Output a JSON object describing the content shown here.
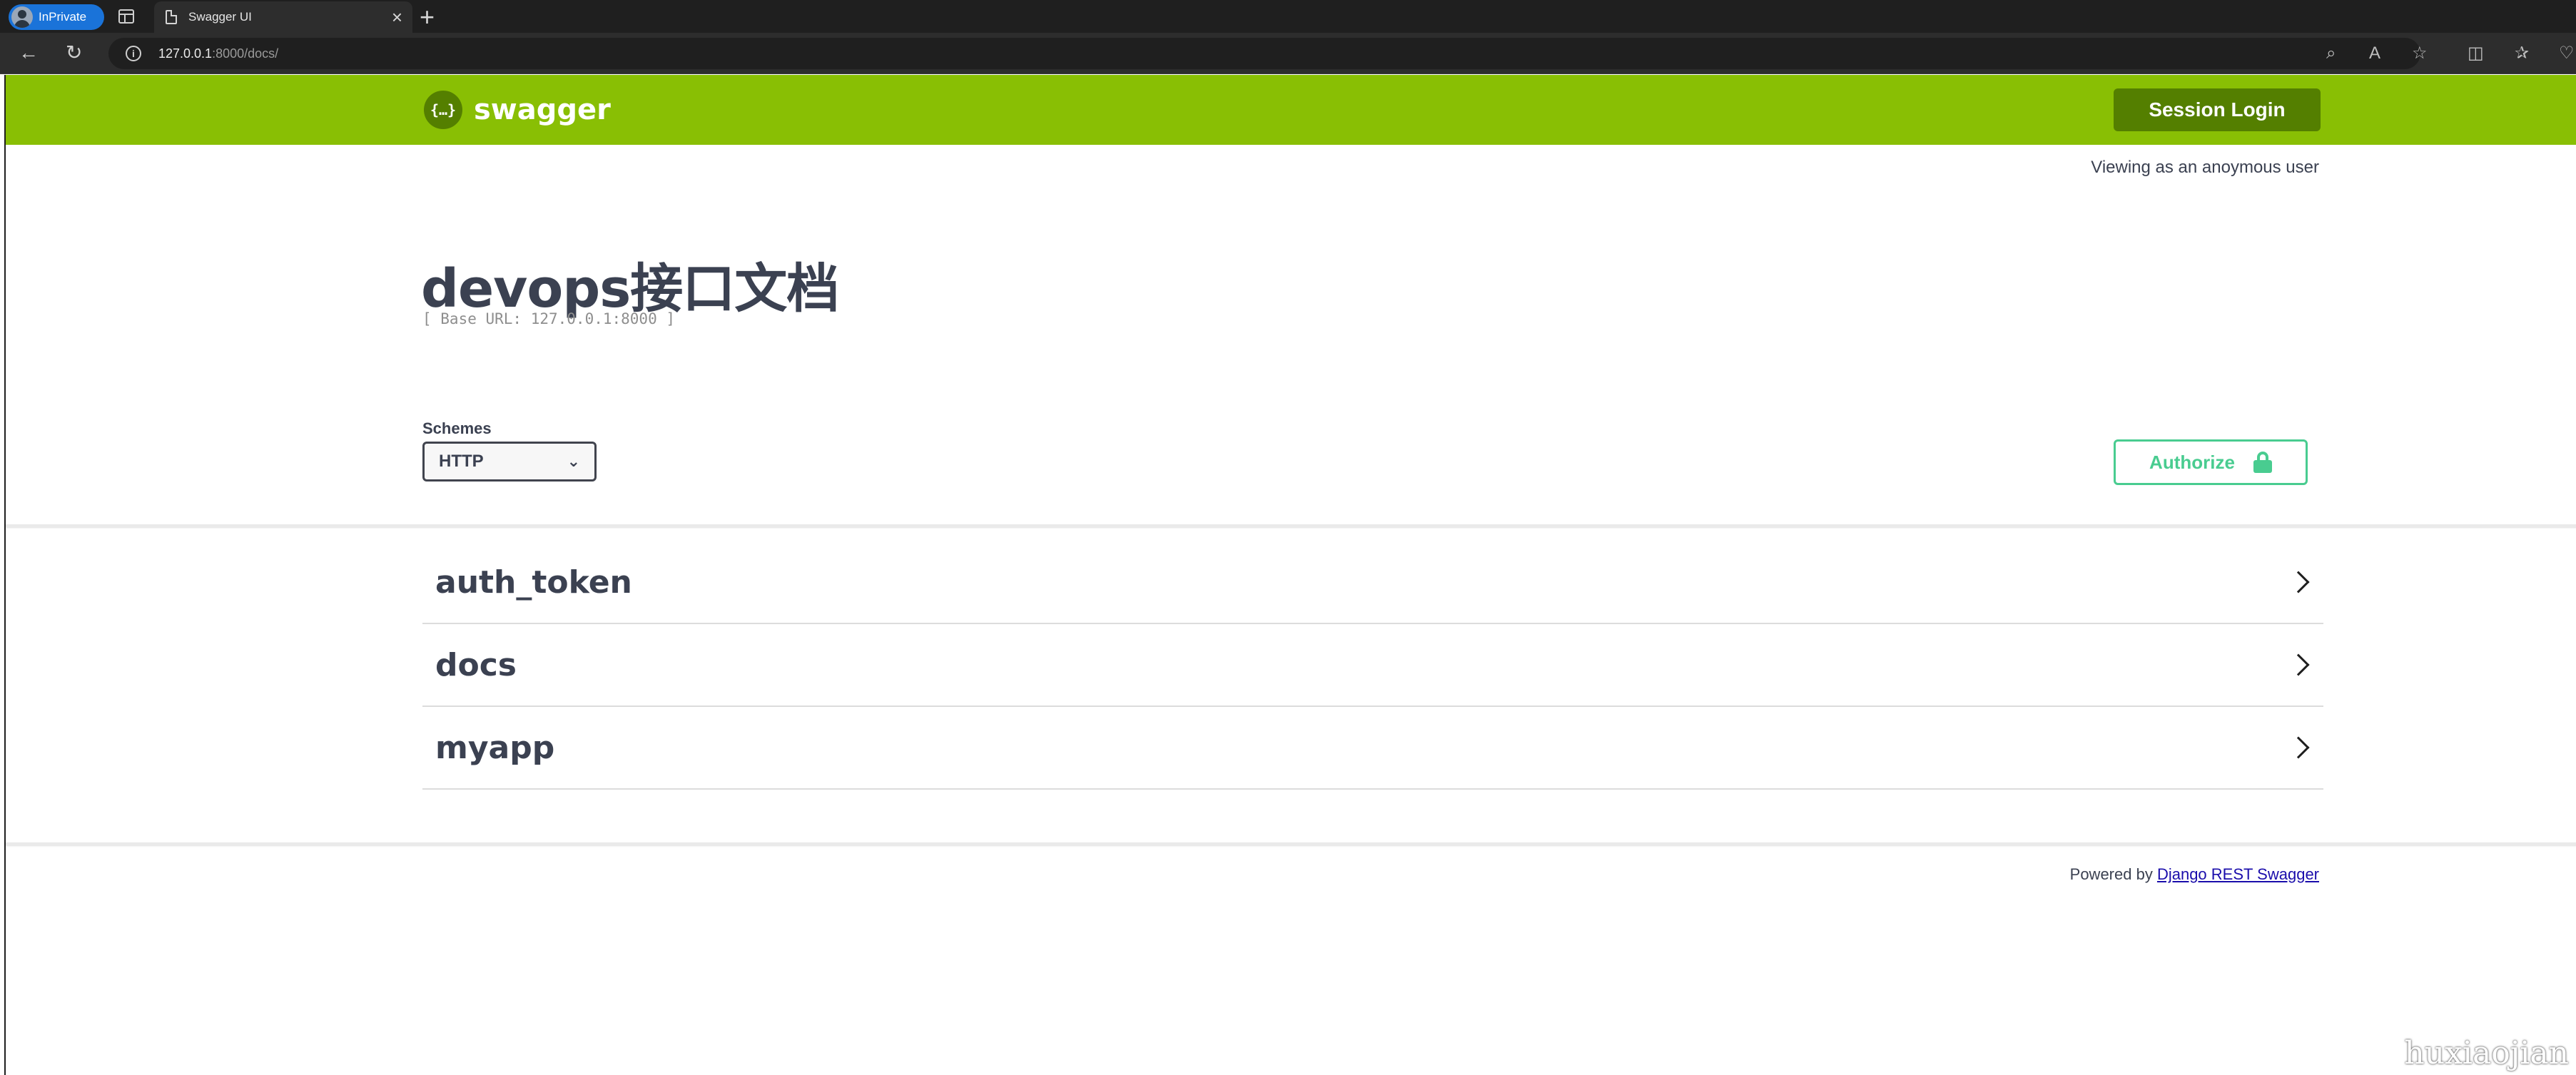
{
  "browser": {
    "profile_badge": "InPrivate",
    "tab_title": "Swagger UI",
    "tab_close": "×",
    "new_tab": "+",
    "url_host": "127.0.0.1",
    "url_rest": ":8000/docs/",
    "nav": {
      "back": "←",
      "reload": "↻"
    },
    "toolbar_icons": [
      "zoom-icon",
      "read-aloud-icon",
      "favorite-icon",
      "split-screen-icon",
      "favorites-icon",
      "browser-essentials-icon"
    ]
  },
  "header": {
    "logo_glyph": "{…}",
    "brand": "swagger",
    "session_login": "Session Login"
  },
  "user_status": "Viewing as an anoymous user",
  "info": {
    "title": "devops接口文档",
    "base_url": "[ Base URL: 127.0.0.1:8000 ]"
  },
  "schemes": {
    "label": "Schemes",
    "selected": "HTTP"
  },
  "authorize": {
    "label": "Authorize"
  },
  "tags": [
    {
      "name": "auth_token"
    },
    {
      "name": "docs"
    },
    {
      "name": "myapp"
    }
  ],
  "footer": {
    "powered_prefix": "Powered by",
    "powered_link": "Django REST Swagger"
  },
  "watermark": "huxiaojian",
  "colors": {
    "topbar": "#89bf04",
    "button_dark_green": "#547f00",
    "authorize_green": "#49cc90",
    "text": "#3b4151"
  }
}
